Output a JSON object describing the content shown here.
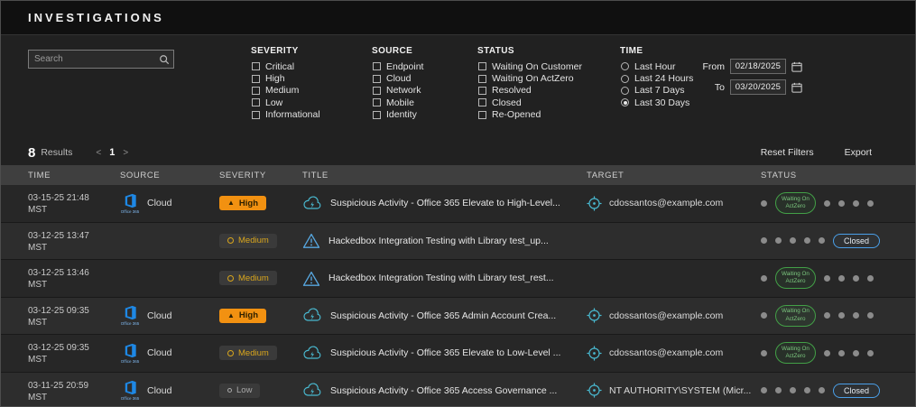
{
  "app": {
    "title": "INVESTIGATIONS"
  },
  "filters": {
    "search": {
      "placeholder": "Search"
    },
    "groups": {
      "severity": {
        "label": "SEVERITY",
        "options": [
          "Critical",
          "High",
          "Medium",
          "Low",
          "Informational"
        ]
      },
      "source": {
        "label": "SOURCE",
        "options": [
          "Endpoint",
          "Cloud",
          "Network",
          "Mobile",
          "Identity"
        ]
      },
      "status": {
        "label": "STATUS",
        "options": [
          "Waiting On Customer",
          "Waiting On ActZero",
          "Resolved",
          "Closed",
          "Re-Opened"
        ]
      },
      "time": {
        "label": "TIME",
        "options": [
          {
            "label": "Last Hour",
            "selected": false
          },
          {
            "label": "Last 24 Hours",
            "selected": false
          },
          {
            "label": "Last 7 Days",
            "selected": false
          },
          {
            "label": "Last 30 Days",
            "selected": true
          }
        ]
      }
    },
    "date_range": {
      "from_label": "From",
      "from_value": "02/18/2025",
      "to_label": "To",
      "to_value": "03/20/2025"
    }
  },
  "results_bar": {
    "count": "8",
    "label": "Results",
    "prev": "<",
    "page": "1",
    "next": ">",
    "reset": "Reset Filters",
    "export": "Export"
  },
  "table": {
    "columns": [
      "TIME",
      "SOURCE",
      "SEVERITY",
      "TITLE",
      "TARGET",
      "STATUS"
    ],
    "colors": {
      "severity_high": "#f29111",
      "severity_medium": "#d9a61d",
      "severity_low": "#a8a8a8",
      "status_waiting": "#43a047",
      "status_closed": "#4a9fe8",
      "icon_teal": "#49b8cf",
      "office_blue": "#1e88e5"
    },
    "rows": [
      {
        "time": "03-15-25 21:48",
        "tz": "MST",
        "source": {
          "icon": "office365-icon",
          "caption": "Office 365",
          "label": "Cloud"
        },
        "severity": {
          "level": "high",
          "label": "High"
        },
        "title": {
          "icon": "cloud-lightning-icon",
          "text": "Suspicious Activity - Office 365 Elevate to High-Level..."
        },
        "target": {
          "icon": "target-icon",
          "text": "cdossantos@example.com"
        },
        "status": {
          "type": "waiting",
          "label_lines": [
            "Waiting On",
            "ActZero"
          ],
          "stage_index": 1,
          "stages": 6
        }
      },
      {
        "time": "03-12-25 13:47",
        "tz": "MST",
        "source": null,
        "severity": {
          "level": "medium",
          "label": "Medium"
        },
        "title": {
          "icon": "alert-triangle-icon",
          "text": "Hackedbox Integration Testing with Library test_up..."
        },
        "target": null,
        "status": {
          "type": "closed",
          "label_lines": [
            "Closed"
          ],
          "stage_index": 5,
          "stages": 6
        }
      },
      {
        "time": "03-12-25 13:46",
        "tz": "MST",
        "source": null,
        "severity": {
          "level": "medium",
          "label": "Medium"
        },
        "title": {
          "icon": "alert-triangle-icon",
          "text": "Hackedbox Integration Testing with Library test_rest..."
        },
        "target": null,
        "status": {
          "type": "waiting",
          "label_lines": [
            "Waiting On",
            "ActZero"
          ],
          "stage_index": 1,
          "stages": 6
        }
      },
      {
        "time": "03-12-25 09:35",
        "tz": "MST",
        "source": {
          "icon": "office365-icon",
          "caption": "Office 365",
          "label": "Cloud"
        },
        "severity": {
          "level": "high",
          "label": "High"
        },
        "title": {
          "icon": "cloud-lightning-icon",
          "text": "Suspicious Activity - Office 365 Admin Account Crea..."
        },
        "target": {
          "icon": "target-icon",
          "text": "cdossantos@example.com"
        },
        "status": {
          "type": "waiting",
          "label_lines": [
            "Waiting On",
            "ActZero"
          ],
          "stage_index": 1,
          "stages": 6
        }
      },
      {
        "time": "03-12-25 09:35",
        "tz": "MST",
        "source": {
          "icon": "office365-icon",
          "caption": "Office 365",
          "label": "Cloud"
        },
        "severity": {
          "level": "medium",
          "label": "Medium"
        },
        "title": {
          "icon": "cloud-lightning-icon",
          "text": "Suspicious Activity - Office 365 Elevate to Low-Level ..."
        },
        "target": {
          "icon": "target-icon",
          "text": "cdossantos@example.com"
        },
        "status": {
          "type": "waiting",
          "label_lines": [
            "Waiting On",
            "ActZero"
          ],
          "stage_index": 1,
          "stages": 6
        }
      },
      {
        "time": "03-11-25 20:59",
        "tz": "MST",
        "source": {
          "icon": "office365-icon",
          "caption": "Office 365",
          "label": "Cloud"
        },
        "severity": {
          "level": "low",
          "label": "Low"
        },
        "title": {
          "icon": "cloud-lightning-icon",
          "text": "Suspicious Activity - Office 365 Access Governance ..."
        },
        "target": {
          "icon": "target-icon",
          "text": "NT AUTHORITY\\SYSTEM (Micr..."
        },
        "status": {
          "type": "closed",
          "label_lines": [
            "Closed"
          ],
          "stage_index": 5,
          "stages": 6
        }
      }
    ]
  }
}
